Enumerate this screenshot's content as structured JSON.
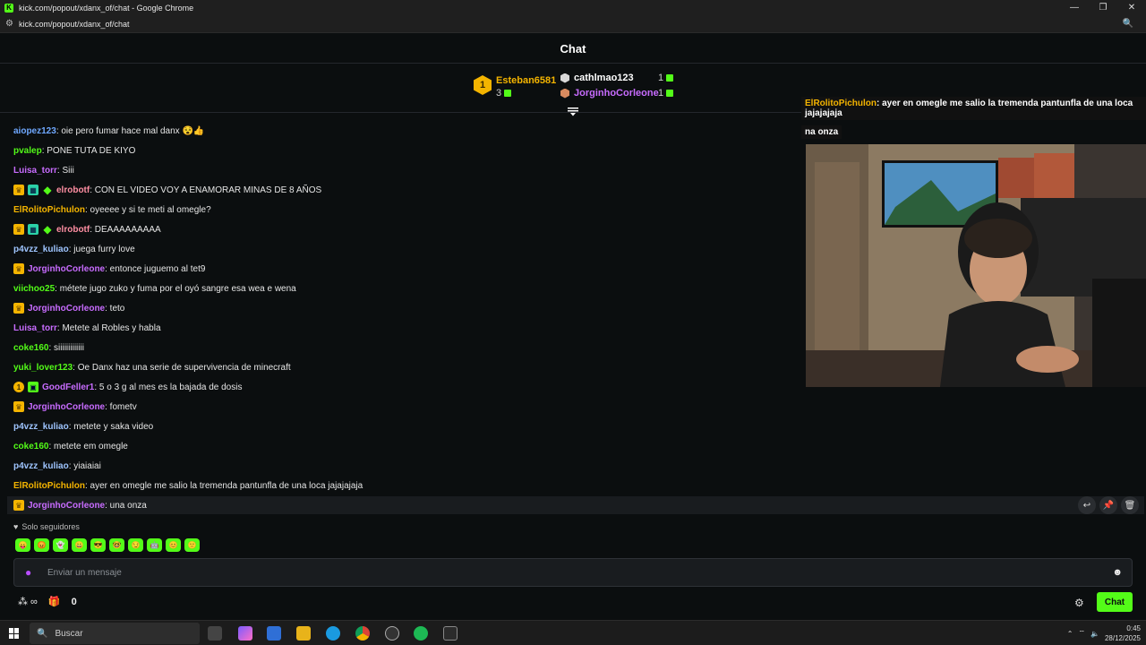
{
  "window": {
    "title": "kick.com/popout/xdanx_of/chat - Google Chrome",
    "url": "kick.com/popout/xdanx_of/chat",
    "controls": [
      "—",
      "❐",
      "✕"
    ]
  },
  "chat_header": {
    "title": "Chat"
  },
  "leaderboard": {
    "first": {
      "rank": "1",
      "name": "Esteban6581",
      "count": "3"
    },
    "others": [
      {
        "name": "cathlmao123",
        "count": "1",
        "color": "#ffffff",
        "hex": "#d9d9d9"
      },
      {
        "name": "JorginhoCorleone",
        "count": "1",
        "color": "#c86cff",
        "hex": "#d98b5f"
      }
    ]
  },
  "messages": [
    {
      "user": "aiopez123",
      "color": "#6fa8ff",
      "text": ": oie pero fumar hace mal danx 😵👍",
      "badges": []
    },
    {
      "user": "pvalep",
      "color": "#53fc18",
      "text": ": PONE TUTA DE KIYO",
      "badges": []
    },
    {
      "user": "Luisa_torr",
      "color": "#c86cff",
      "text": ": Siii",
      "badges": []
    },
    {
      "user": "elrobotf",
      "color": "#ff8fa3",
      "text": ": CON EL VIDEO VOY A ENAMORAR MINAS DE 8 AÑOS",
      "badges": [
        "crown",
        "sub",
        "gem"
      ]
    },
    {
      "user": "ElRolitoPichulon",
      "color": "#f4b400",
      "text": ": oyeeee y si te meti al omegle?",
      "badges": []
    },
    {
      "user": "elrobotf",
      "color": "#ff8fa3",
      "text": ": DEAAAAAAAAA",
      "badges": [
        "crown",
        "sub",
        "gem"
      ]
    },
    {
      "user": "p4vzz_kuliao",
      "color": "#9fc5ff",
      "text": ": juega furry love",
      "badges": []
    },
    {
      "user": "JorginhoCorleone",
      "color": "#c86cff",
      "text": ": entonce juguemo al tet9",
      "badges": [
        "crown"
      ]
    },
    {
      "user": "viichoo25",
      "color": "#53fc18",
      "text": ": métete jugo zuko y fuma por el oyó sangre esa wea e wena",
      "badges": []
    },
    {
      "user": "JorginhoCorleone",
      "color": "#c86cff",
      "text": ": teto",
      "badges": [
        "crown"
      ]
    },
    {
      "user": "Luisa_torr",
      "color": "#c86cff",
      "text": ": Metete al Robles y habla",
      "badges": []
    },
    {
      "user": "coke160",
      "color": "#53fc18",
      "text": ": siiiiiiiiiiiii",
      "badges": []
    },
    {
      "user": "yuki_lover123",
      "color": "#53fc18",
      "text": ": Oe Danx haz una serie de supervivencia de minecraft",
      "badges": []
    },
    {
      "user": "GoodFeller1",
      "color": "#c86cff",
      "text": ": 5 o 3 g al mes es la bajada de dosis",
      "badges": [
        "coin",
        "gift"
      ]
    },
    {
      "user": "JorginhoCorleone",
      "color": "#c86cff",
      "text": ": fometv",
      "badges": [
        "crown"
      ]
    },
    {
      "user": "p4vzz_kuliao",
      "color": "#9fc5ff",
      "text": ": metete y saka video",
      "badges": []
    },
    {
      "user": "coke160",
      "color": "#53fc18",
      "text": ": metete em omegle",
      "badges": []
    },
    {
      "user": "p4vzz_kuliao",
      "color": "#9fc5ff",
      "text": ": yiaiaiai",
      "badges": []
    },
    {
      "user": "ElRolitoPichulon",
      "color": "#f4b400",
      "text": ": ayer en omegle me salio la tremenda pantunfla de una loca jajajajaja",
      "badges": []
    },
    {
      "user": "JorginhoCorleone",
      "color": "#c86cff",
      "text": ": una onza",
      "badges": [
        "crown"
      ]
    }
  ],
  "message_actions": [
    "↩",
    "📌",
    "🗑"
  ],
  "overlay": {
    "user": "ElRolitoPichulon",
    "text": ": ayer en omegle me salio la tremenda pantunfla de una loca jajajajaja",
    "line2": "na onza"
  },
  "followers_only": "Solo seguidores",
  "emotes": [
    "😛",
    "😡",
    "👻",
    "😀",
    "😎",
    "🤓",
    "😏",
    "🤖",
    "😊",
    "🙂"
  ],
  "input": {
    "placeholder": "Enviar un mensaje"
  },
  "bottom": {
    "points": "0",
    "chat_button": "Chat"
  },
  "taskbar": {
    "search_placeholder": "Buscar",
    "time": "0:45",
    "date": "28/12/2025"
  },
  "colors": {
    "accent": "#53fc18",
    "background": "#0b0e0f"
  }
}
